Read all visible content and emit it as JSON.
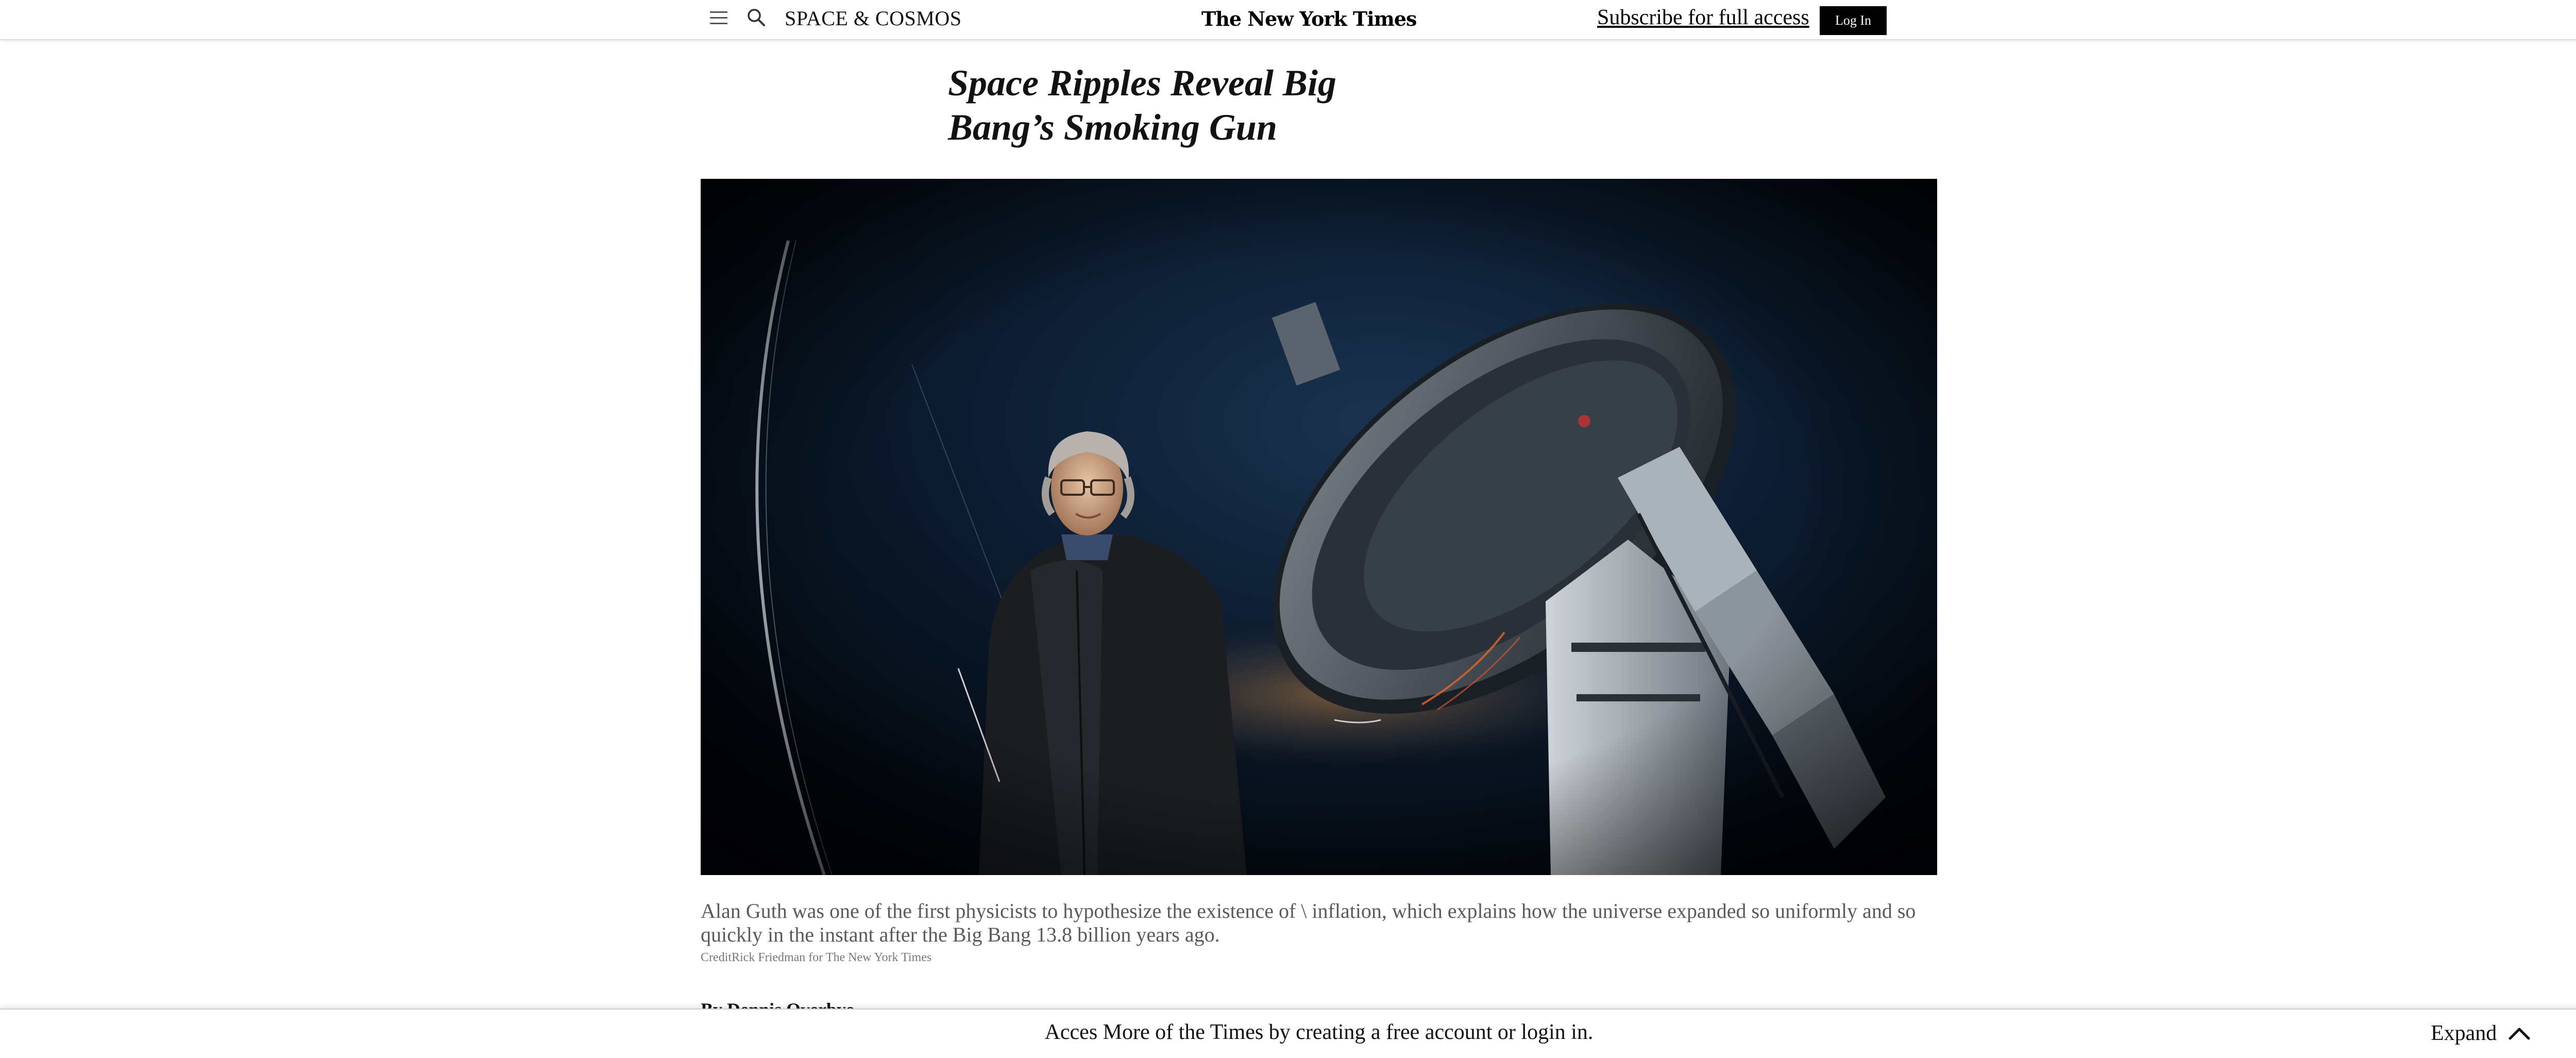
{
  "header": {
    "section": "SPACE & COSMOS",
    "logo": "The New York Times",
    "subscribe": "Subscribe for full access",
    "login": "Log In",
    "menu_icon": "hamburger-menu-icon",
    "search_icon": "search-icon"
  },
  "article": {
    "headline_line1": "Space Ripples Reveal Big",
    "headline_line2": "Bang’s Smoking Gun",
    "photo_description_icon": "photo",
    "caption": "Alan Guth was one of the first physicists to hypothesize the existence of \\ inflation, which explains how the universe expanded so uniformly and so quickly in the instant after the Big Bang 13.8 billion years ago.",
    "credit": "CreditRick Friedman for The New York Times",
    "byline": "By Dennis Overbye"
  },
  "banner": {
    "message": "Acces More of the Times by creating a free account or login in.",
    "expand": "Expand",
    "expand_icon": "chevron-up-icon"
  },
  "colors": {
    "text": "#121212",
    "caption": "#5a5a5a",
    "login_bg": "#000000",
    "photo_sky": "#0b1a2c"
  }
}
